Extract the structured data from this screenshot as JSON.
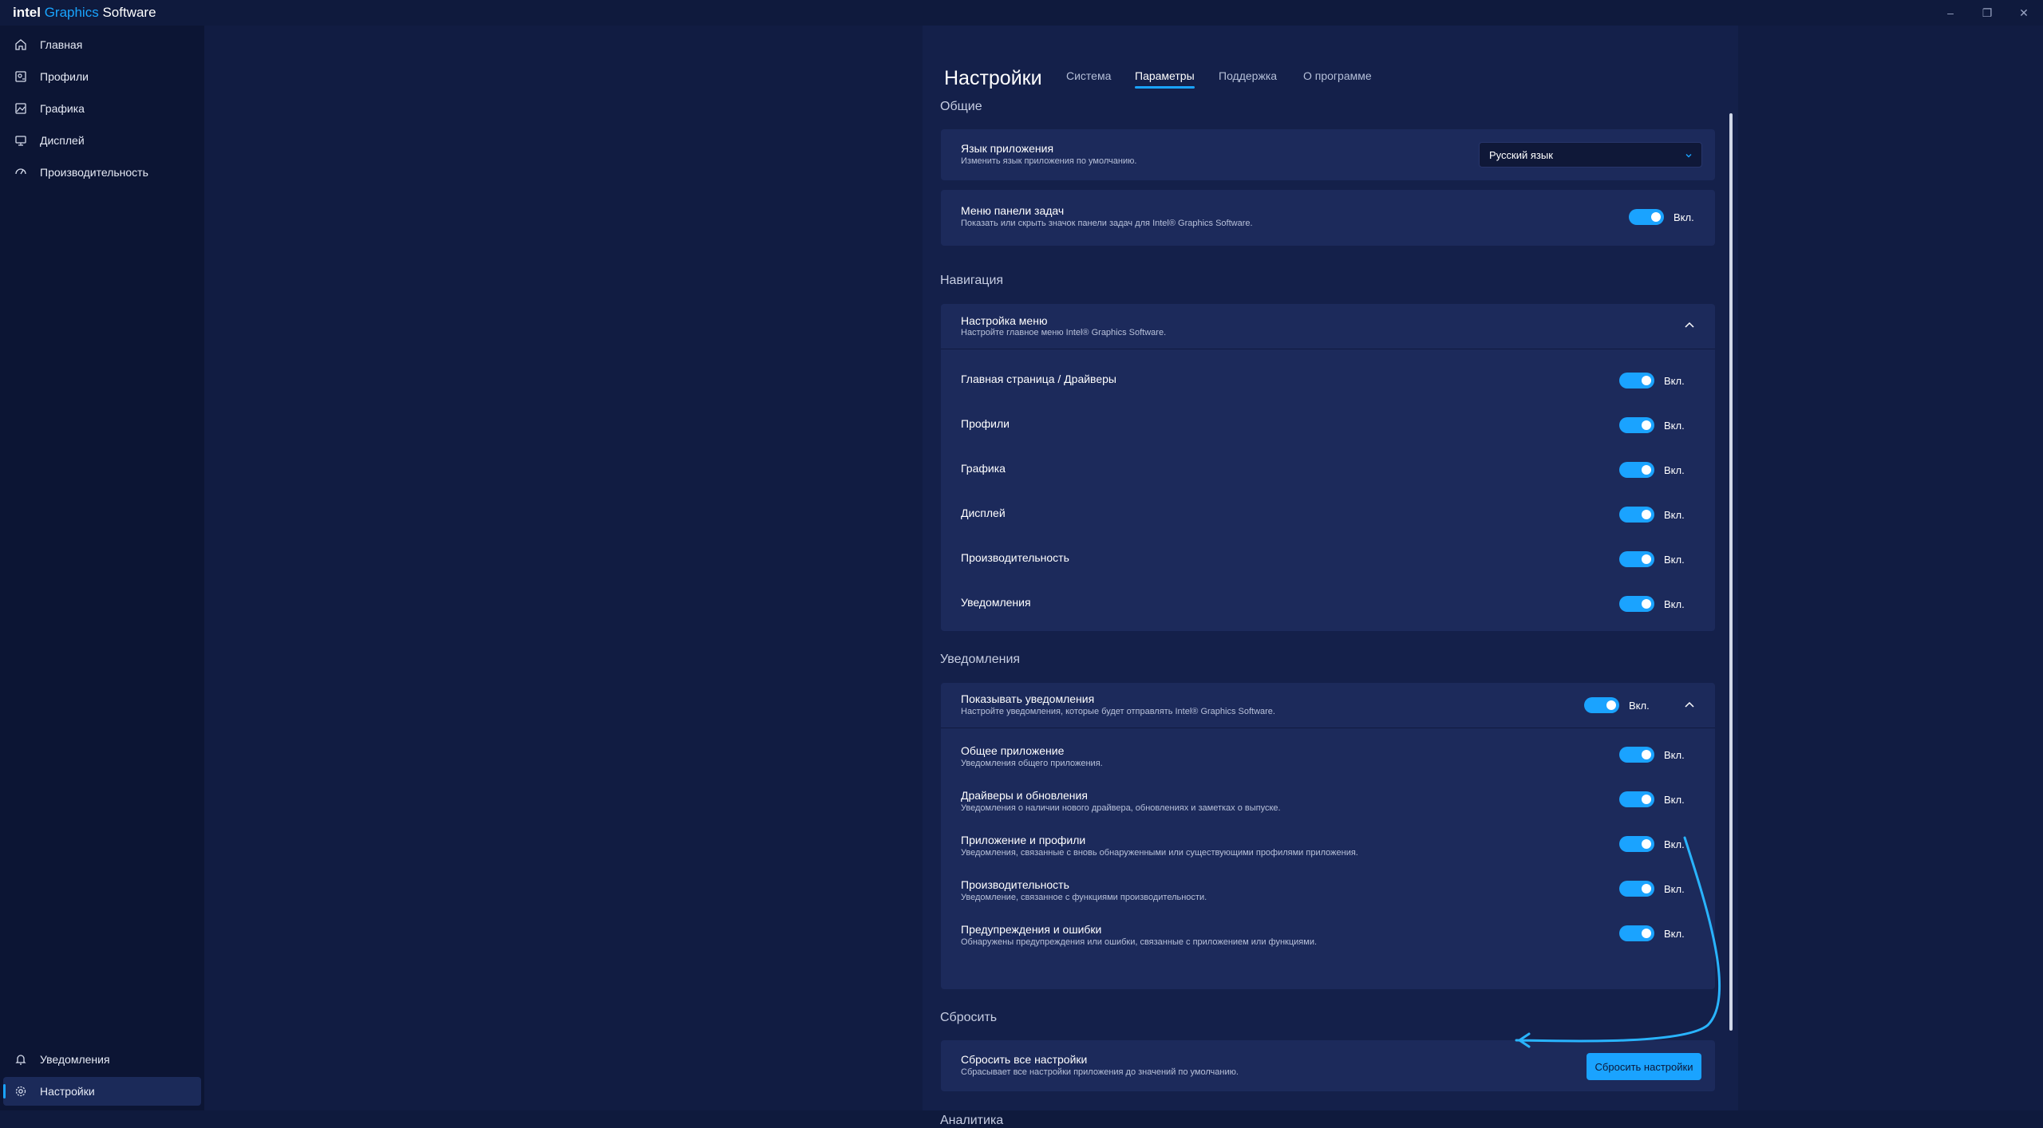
{
  "app": {
    "brand_intel": "intel",
    "brand_graphics": "Graphics",
    "brand_software": "Software",
    "window_controls": [
      "–",
      "❐",
      "✕"
    ]
  },
  "sidebar": {
    "items": [
      {
        "label": "Главная",
        "icon": "home-icon"
      },
      {
        "label": "Профили",
        "icon": "profiles-icon"
      },
      {
        "label": "Графика",
        "icon": "graphics-icon"
      },
      {
        "label": "Дисплей",
        "icon": "display-icon"
      },
      {
        "label": "Производительность",
        "icon": "performance-icon"
      }
    ],
    "bottom_items": [
      {
        "label": "Уведомления",
        "icon": "bell-icon"
      },
      {
        "label": "Настройки",
        "icon": "gear-icon",
        "active": true
      }
    ]
  },
  "header": {
    "title": "Настройки",
    "tabs": [
      "Система",
      "Параметры",
      "Поддержка",
      "О программе"
    ],
    "active_tab": "Параметры"
  },
  "sections": {
    "general": {
      "title": "Общие",
      "language": {
        "title": "Язык приложения",
        "subtitle": "Изменить язык приложения по умолчанию.",
        "value": "Русский язык"
      },
      "taskbar": {
        "title": "Меню панели задач",
        "subtitle": "Показать или скрыть значок панели задач для Intel® Graphics Software.",
        "toggle_label": "Вкл.",
        "on": true
      }
    },
    "navigation": {
      "title": "Навигация",
      "menu": {
        "title": "Настройка меню",
        "subtitle": "Настройте главное меню Intel® Graphics Software."
      },
      "items": [
        {
          "label": "Главная страница / Драйверы",
          "toggle_label": "Вкл."
        },
        {
          "label": "Профили",
          "toggle_label": "Вкл."
        },
        {
          "label": "Графика",
          "toggle_label": "Вкл."
        },
        {
          "label": "Дисплей",
          "toggle_label": "Вкл."
        },
        {
          "label": "Производительность",
          "toggle_label": "Вкл."
        },
        {
          "label": "Уведомления",
          "toggle_label": "Вкл."
        }
      ]
    },
    "notifications": {
      "title": "Уведомления",
      "show": {
        "title": "Показывать уведомления",
        "subtitle": "Настройте уведомления, которые будет отправлять Intel® Graphics Software.",
        "toggle_label": "Вкл."
      },
      "items": [
        {
          "title": "Общее приложение",
          "subtitle": "Уведомления общего приложения.",
          "toggle_label": "Вкл."
        },
        {
          "title": "Драйверы и обновления",
          "subtitle": "Уведомления о наличии нового драйвера, обновлениях и заметках о выпуске.",
          "toggle_label": "Вкл."
        },
        {
          "title": "Приложение и профили",
          "subtitle": "Уведомления, связанные с вновь обнаруженными или существующими профилями приложения.",
          "toggle_label": "Вкл."
        },
        {
          "title": "Производительность",
          "subtitle": "Уведомление, связанное с функциями производительности.",
          "toggle_label": "Вкл."
        },
        {
          "title": "Предупреждения и ошибки",
          "subtitle": "Обнаружены предупреждения или ошибки, связанные с приложением или функциями.",
          "toggle_label": "Вкл."
        }
      ]
    },
    "reset": {
      "title": "Сбросить",
      "card": {
        "title": "Сбросить все настройки",
        "subtitle": "Сбрасывает все настройки приложения до значений по умолчанию.",
        "button": "Сбросить настройки"
      }
    },
    "analytics": {
      "title": "Аналитика"
    }
  },
  "colors": {
    "accent": "#1aa3ff",
    "background": "#111c42",
    "card": "#1c2a5b"
  }
}
